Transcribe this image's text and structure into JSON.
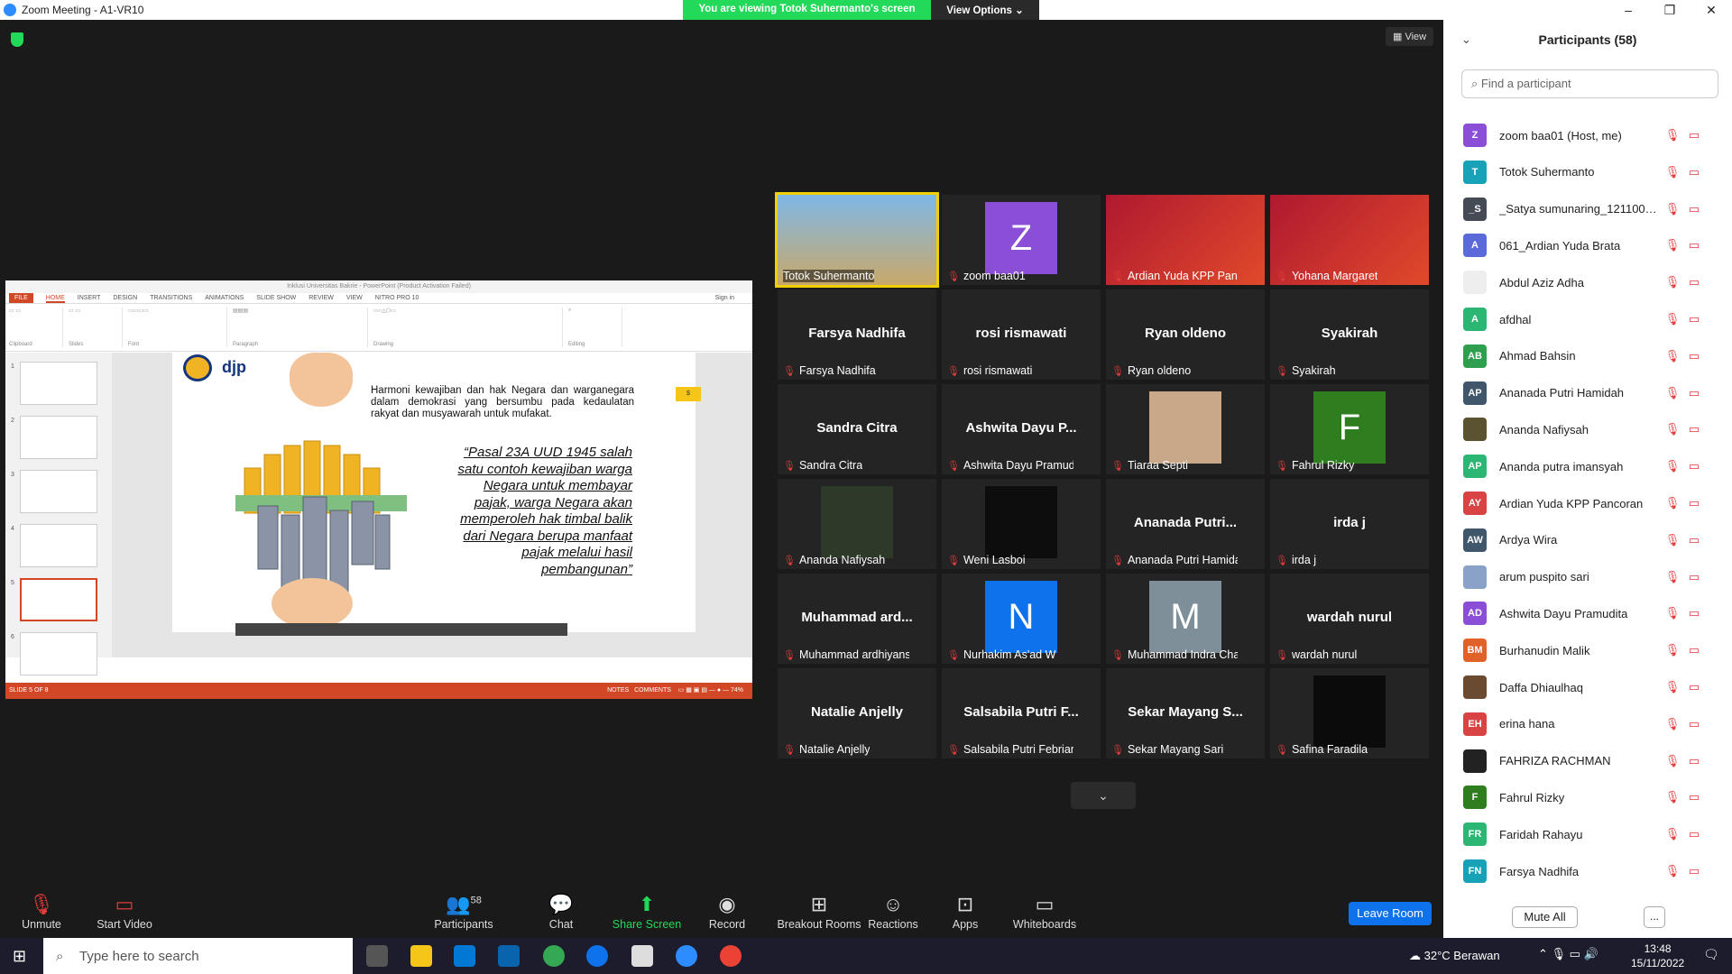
{
  "window": {
    "title": "Zoom Meeting - A1-VR10"
  },
  "share": {
    "message": "You are viewing Totok Suhermanto's screen",
    "options": "View Options ⌄"
  },
  "view_label": "View",
  "ppt": {
    "title": "Inklusi Universitas Bakrie - PowerPoint (Product Activation Failed)",
    "tabs": [
      "FILE",
      "HOME",
      "INSERT",
      "DESIGN",
      "TRANSITIONS",
      "ANIMATIONS",
      "SLIDE SHOW",
      "REVIEW",
      "VIEW",
      "NITRO PRO 10"
    ],
    "signin": "Sign in",
    "groups": [
      "Clipboard",
      "Slides",
      "Font",
      "Paragraph",
      "Drawing",
      "Editing"
    ],
    "slide_paragraph": "Harmoni kewajiban dan hak Negara dan warganegara dalam demokrasi yang bersumbu pada kedaulatan rakyat dan musyawarah untuk mufakat.",
    "slide_quote": "“Pasal 23A UUD 1945 salah satu contoh kewajiban warga Negara untuk membayar pajak, warga Negara akan memperoleh hak timbal balik dari Negara berupa manfaat pajak melalui hasil pembangunan”",
    "logo": "djp",
    "tag": "$",
    "status_left": "SLIDE 5 OF 8",
    "status_notes": "NOTES",
    "status_comments": "COMMENTS",
    "zoom_pct": "74%",
    "thumb_numbers": [
      "1",
      "2",
      "3",
      "4",
      "5",
      "6"
    ]
  },
  "gallery": [
    {
      "big": "",
      "name": "Totok Suhermanto",
      "active": true,
      "video": "beach"
    },
    {
      "big": "",
      "name": "zoom baa01",
      "avatar": "Z",
      "avcolor": "#8a4fd6"
    },
    {
      "big": "",
      "name": "Ardian Yuda KPP Pancor...",
      "video": "g20"
    },
    {
      "big": "",
      "name": "Yohana Margaret",
      "video": "g20"
    },
    {
      "big": "Farsya Nadhifa",
      "name": "Farsya Nadhifa"
    },
    {
      "big": "rosi rismawati",
      "name": "rosi rismawati"
    },
    {
      "big": "Ryan oldeno",
      "name": "Ryan oldeno"
    },
    {
      "big": "Syakirah",
      "name": "Syakirah"
    },
    {
      "big": "Sandra Citra",
      "name": "Sandra Citra"
    },
    {
      "big": "Ashwita Dayu P...",
      "name": "Ashwita Dayu Pramudita"
    },
    {
      "big": "",
      "name": "Tiaraa Septi",
      "video": "photo"
    },
    {
      "big": "",
      "name": "Fahrul Rizky",
      "avatar": "F",
      "avcolor": "#2e7d1f"
    },
    {
      "big": "",
      "name": "Ananda Nafiysah",
      "video": "photo2"
    },
    {
      "big": "",
      "name": "Weni Lasboi",
      "video": "black"
    },
    {
      "big": "Ananada Putri...",
      "name": "Ananada Putri Hamidah"
    },
    {
      "big": "irda j",
      "name": "irda j"
    },
    {
      "big": "Muhammad ard...",
      "name": "Muhammad ardhiyansy..."
    },
    {
      "big": "",
      "name": "Nurhakim As'ad W",
      "avatar": "N",
      "avcolor": "#0e72ed"
    },
    {
      "big": "",
      "name": "Muhammad Indra Chaidir",
      "avatar": "M",
      "avcolor": "#7f8f99"
    },
    {
      "big": "wardah nurul",
      "name": "wardah nurul"
    },
    {
      "big": "Natalie Anjelly",
      "name": "Natalie Anjelly"
    },
    {
      "big": "Salsabila Putri F...",
      "name": "Salsabila Putri Febrianti"
    },
    {
      "big": "Sekar Mayang S...",
      "name": "Sekar Mayang Sari"
    },
    {
      "big": "",
      "name": "Safina Faradila",
      "video": "stars"
    }
  ],
  "panel": {
    "title": "Participants (58)",
    "search_placeholder": "Find a participant",
    "mute_all": "Mute All",
    "more": "...",
    "rows": [
      {
        "initial": "Z",
        "color": "#8a4fd6",
        "name": "zoom baa01 (Host, me)"
      },
      {
        "initial": "T",
        "color": "#17a2b8",
        "name": "Totok Suhermanto"
      },
      {
        "initial": "_S",
        "color": "#444b55",
        "name": "_Satya sumunaring_121100104..."
      },
      {
        "initial": "A",
        "color": "#5a6ad9",
        "name": "061_Ardian Yuda Brata"
      },
      {
        "initial": "",
        "color": "#eeeeee",
        "name": "Abdul Aziz Adha"
      },
      {
        "initial": "A",
        "color": "#2bb673",
        "name": "afdhal"
      },
      {
        "initial": "AB",
        "color": "#2e9e4f",
        "name": "Ahmad Bahsin"
      },
      {
        "initial": "AP",
        "color": "#40566b",
        "name": "Ananada Putri Hamidah"
      },
      {
        "initial": "",
        "color": "#5a5230",
        "name": "Ananda Nafiysah"
      },
      {
        "initial": "AP",
        "color": "#2bb673",
        "name": "Ananda putra imansyah"
      },
      {
        "initial": "AY",
        "color": "#d94343",
        "name": "Ardian Yuda KPP Pancoran"
      },
      {
        "initial": "AW",
        "color": "#40566b",
        "name": "Ardya Wira"
      },
      {
        "initial": "",
        "color": "#8aa2c8",
        "name": "arum puspito sari"
      },
      {
        "initial": "AD",
        "color": "#8a4fd6",
        "name": "Ashwita Dayu Pramudita"
      },
      {
        "initial": "BM",
        "color": "#e0622a",
        "name": "Burhanudin Malik"
      },
      {
        "initial": "",
        "color": "#6b4a32",
        "name": "Daffa Dhiaulhaq"
      },
      {
        "initial": "EH",
        "color": "#d94343",
        "name": "erina hana"
      },
      {
        "initial": "",
        "color": "#222222",
        "name": "FAHRIZA RACHMAN"
      },
      {
        "initial": "F",
        "color": "#2e7d1f",
        "name": "Fahrul Rizky"
      },
      {
        "initial": "FR",
        "color": "#2bb673",
        "name": "Faridah Rahayu"
      },
      {
        "initial": "FN",
        "color": "#17a2b8",
        "name": "Farsya Nadhifa"
      }
    ]
  },
  "toolbar": {
    "unmute": "Unmute",
    "video": "Start Video",
    "participants": "Participants",
    "count": "58",
    "chat": "Chat",
    "share": "Share Screen",
    "record": "Record",
    "breakout": "Breakout Rooms",
    "reactions": "Reactions",
    "apps": "Apps",
    "whiteboards": "Whiteboards",
    "leave": "Leave Room"
  },
  "taskbar": {
    "search": "Type here to search",
    "weather": "32°C  Berawan",
    "time": "13:48",
    "date": "15/11/2022"
  }
}
